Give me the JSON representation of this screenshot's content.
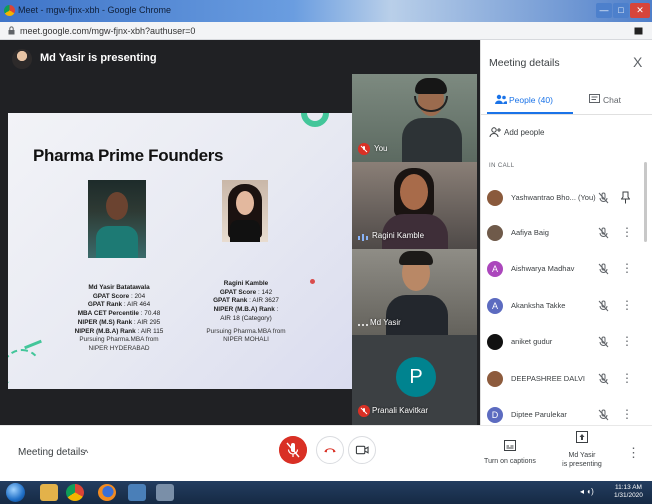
{
  "window": {
    "title": "Meet - mgw-fjnx-xbh - Google Chrome",
    "min_label": "—",
    "max_label": "□",
    "close_label": "✕"
  },
  "address": {
    "url": "meet.google.com/mgw-fjnx-xbh?authuser=0"
  },
  "presentation": {
    "presenting_text": "Md Yasir is presenting"
  },
  "slide": {
    "title": "Pharma Prime Founders",
    "person1": {
      "name": "Md Yasir Batatawala",
      "lines": [
        {
          "label": "GPAT Score",
          "value": ": 204"
        },
        {
          "label": "GPAT Rank",
          "value": ": AIR 464"
        },
        {
          "label": "MBA CET Percentile",
          "value": ": 70.48"
        },
        {
          "label": "NIPER (M.S) Rank",
          "value": ": AIR 295"
        },
        {
          "label": "NIPER (M.B.A) Rank",
          "value": ": AIR 115"
        }
      ],
      "pursuing": "Pursuing Pharma.MBA from",
      "institute": "NIPER HYDERABAD"
    },
    "person2": {
      "name": "Ragini Kamble",
      "lines": [
        {
          "label": "GPAT Score",
          "value": ": 142"
        },
        {
          "label": "GPAT Rank",
          "value": ": AIR 3627"
        },
        {
          "label": "NIPER (M.B.A) Rank",
          "value": ":"
        }
      ],
      "extra": "AIR 18 (Category)",
      "pursuing": "Pursuing Pharma.MBA from",
      "institute": "NIPER MOHALI"
    }
  },
  "tiles": [
    {
      "label": "You"
    },
    {
      "label": "Ragini Kamble"
    },
    {
      "label": "Md Yasir"
    },
    {
      "label": "Pranali Kavitkar",
      "initial": "P"
    }
  ],
  "panel": {
    "title": "Meeting details",
    "close": "X",
    "tab_people": "People (40)",
    "tab_chat": "Chat",
    "add_people": "Add people",
    "section": "IN CALL",
    "participants": [
      {
        "name": "Yashwantrao Bho... (You)",
        "color": "#8a5a3c",
        "initial": ""
      },
      {
        "name": "Aafiya Baig",
        "color": "#6f5a4a",
        "initial": ""
      },
      {
        "name": "Aishwarya Madhav",
        "color": "#ab47bc",
        "initial": "A"
      },
      {
        "name": "Akanksha Takke",
        "color": "#5c6bc0",
        "initial": "A"
      },
      {
        "name": "aniket gudur",
        "color": "#111111",
        "initial": ""
      },
      {
        "name": "DEEPASHREE DALVI",
        "color": "#8d5b3d",
        "initial": ""
      },
      {
        "name": "Diptee Parulekar",
        "color": "#5c6bc0",
        "initial": "D"
      }
    ]
  },
  "bottom": {
    "meeting_details": "Meeting details",
    "chevron": "^",
    "captions": "Turn on captions",
    "presenter_line1": "Md Yasir",
    "presenter_line2": "is presenting"
  },
  "taskbar": {
    "time": "11:13 AM",
    "date": "1/31/2020"
  }
}
